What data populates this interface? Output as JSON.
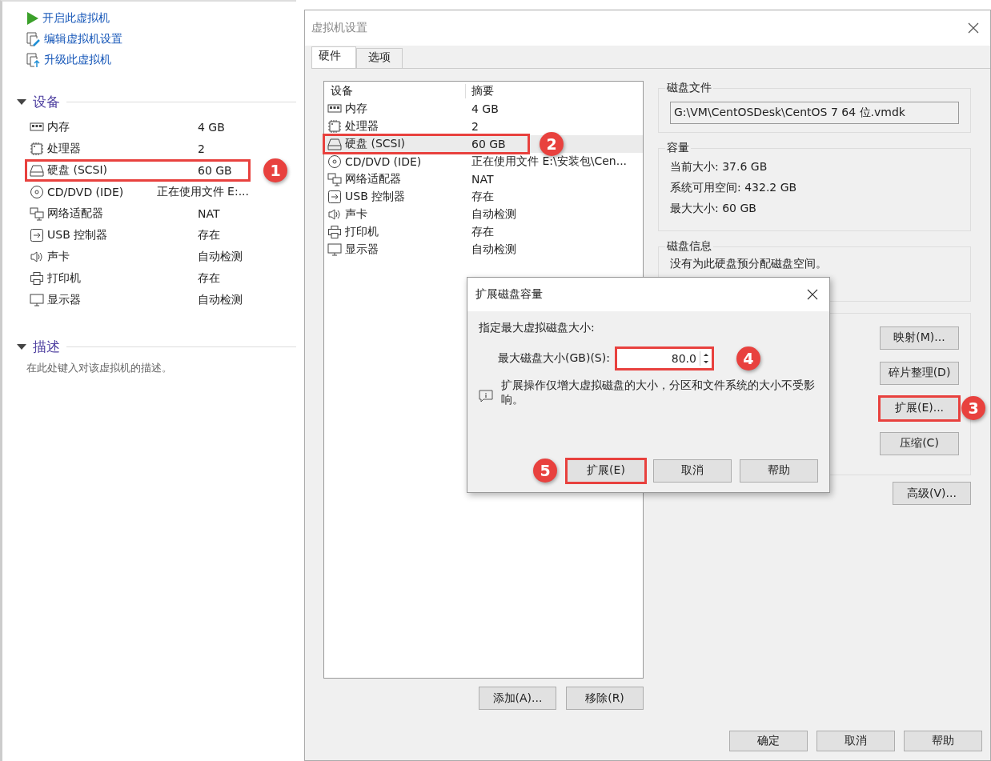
{
  "left_panel": {
    "actions": [
      {
        "kind": "play",
        "label": "开启此虚拟机"
      },
      {
        "kind": "edit",
        "label": "编辑虚拟机设置"
      },
      {
        "kind": "upgrade",
        "label": "升级此虚拟机"
      }
    ],
    "devices_section": {
      "title": "设备",
      "expanded": true,
      "items": [
        {
          "kind": "memory",
          "name": "内存",
          "summary": "4 GB"
        },
        {
          "kind": "cpu",
          "name": "处理器",
          "summary": "2"
        },
        {
          "kind": "disk",
          "name": "硬盘 (SCSI)",
          "summary": "60 GB",
          "annotation": "1"
        },
        {
          "kind": "cd",
          "name": "CD/DVD (IDE)",
          "summary": "正在使用文件 E:..."
        },
        {
          "kind": "network",
          "name": "网络适配器",
          "summary": "NAT"
        },
        {
          "kind": "usb",
          "name": "USB 控制器",
          "summary": "存在"
        },
        {
          "kind": "sound",
          "name": "声卡",
          "summary": "自动检测"
        },
        {
          "kind": "printer",
          "name": "打印机",
          "summary": "存在"
        },
        {
          "kind": "display",
          "name": "显示器",
          "summary": "自动检测"
        }
      ]
    },
    "description_section": {
      "title": "描述",
      "expanded": true,
      "text": "在此处键入对该虚拟机的描述。"
    }
  },
  "settings_window": {
    "title": "虚拟机设置",
    "tabs": [
      {
        "label": "硬件",
        "selected": true
      },
      {
        "label": "选项",
        "selected": false
      }
    ],
    "device_table": {
      "columns": [
        "设备",
        "摘要"
      ],
      "rows": [
        {
          "kind": "memory",
          "name": "内存",
          "summary": "4 GB",
          "selected": false
        },
        {
          "kind": "cpu",
          "name": "处理器",
          "summary": "2",
          "selected": false
        },
        {
          "kind": "disk",
          "name": "硬盘 (SCSI)",
          "summary": "60 GB",
          "selected": true,
          "annotation": "2"
        },
        {
          "kind": "cd",
          "name": "CD/DVD (IDE)",
          "summary": "正在使用文件 E:\\安装包\\Cen...",
          "selected": false
        },
        {
          "kind": "network",
          "name": "网络适配器",
          "summary": "NAT",
          "selected": false
        },
        {
          "kind": "usb",
          "name": "USB 控制器",
          "summary": "存在",
          "selected": false
        },
        {
          "kind": "sound",
          "name": "声卡",
          "summary": "自动检测",
          "selected": false
        },
        {
          "kind": "printer",
          "name": "打印机",
          "summary": "存在",
          "selected": false
        },
        {
          "kind": "display",
          "name": "显示器",
          "summary": "自动检测",
          "selected": false
        }
      ]
    },
    "list_buttons": [
      {
        "label": "添加(A)..."
      },
      {
        "label": "移除(R)"
      }
    ],
    "disk_file": {
      "title": "磁盘文件",
      "value": "G:\\VM\\CentOSDesk\\CentOS 7 64 位.vmdk"
    },
    "capacity": {
      "title": "容量",
      "lines": [
        "当前大小: 37.6 GB",
        "系统可用空间: 432.2 GB",
        "最大大小: 60 GB"
      ]
    },
    "disk_info": {
      "title": "磁盘信息",
      "text": "没有为此硬盘预分配磁盘空间。"
    },
    "utility_buttons": [
      {
        "label": "映射(M)..."
      },
      {
        "label": "碎片整理(D)"
      },
      {
        "label": "扩展(E)...",
        "annotation": "3"
      },
      {
        "label": "压缩(C)"
      }
    ],
    "advanced_button": "高级(V)...",
    "footer_buttons": [
      "确定",
      "取消",
      "帮助"
    ]
  },
  "expand_dialog": {
    "title": "扩展磁盘容量",
    "prompt": "指定最大虚拟磁盘大小:",
    "field_label": "最大磁盘大小(GB)(S):",
    "value": "80.0",
    "field_annotation": "4",
    "note": "扩展操作仅增大虚拟磁盘的大小，分区和文件系统的大小不受影响。",
    "buttons": [
      {
        "label": "扩展(E)",
        "annotation": "5"
      },
      {
        "label": "取消"
      },
      {
        "label": "帮助"
      }
    ]
  }
}
